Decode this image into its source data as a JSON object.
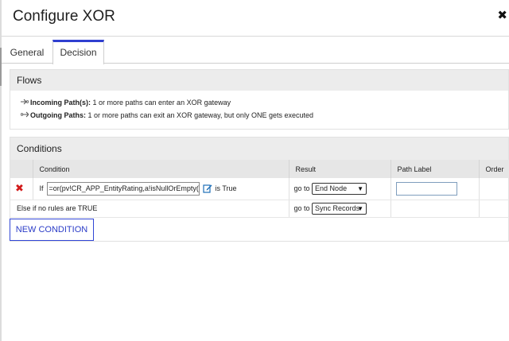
{
  "dialog": {
    "title": "Configure XOR",
    "close_glyph": "✖"
  },
  "tabs": [
    {
      "label": "General",
      "active": false
    },
    {
      "label": "Decision",
      "active": true
    }
  ],
  "flows": {
    "heading": "Flows",
    "incoming_label": "Incoming Path(s):",
    "incoming_text": " 1 or more paths can enter an XOR gateway",
    "outgoing_label": "Outgoing Paths:",
    "outgoing_text": " 1 or more paths can exit an XOR gateway, but only ONE gets executed"
  },
  "conditions": {
    "heading": "Conditions",
    "columns": [
      "Condition",
      "Result",
      "Path Label",
      "Order"
    ],
    "rows": [
      {
        "prefix": "If",
        "expression": "=or(pv!CR_APP_EntityRating,a!isNullOrEmpty(pr",
        "suffix": "is True",
        "goto": "go to",
        "result": "End Node",
        "path_label": ""
      }
    ],
    "else_row": {
      "label": "Else if no rules are TRUE",
      "goto": "go to",
      "result": "Sync Records"
    },
    "new_button": "NEW CONDITION"
  },
  "icons": {
    "delete": "delete-x-icon",
    "edit": "edit-expression-icon",
    "arrow_in": "incoming-arrow-icon",
    "arrow_out": "outgoing-arrow-icon"
  },
  "colors": {
    "accent": "#2f3fd0",
    "delete": "#d21a1a",
    "edit_icon": "#1d6fb8"
  }
}
